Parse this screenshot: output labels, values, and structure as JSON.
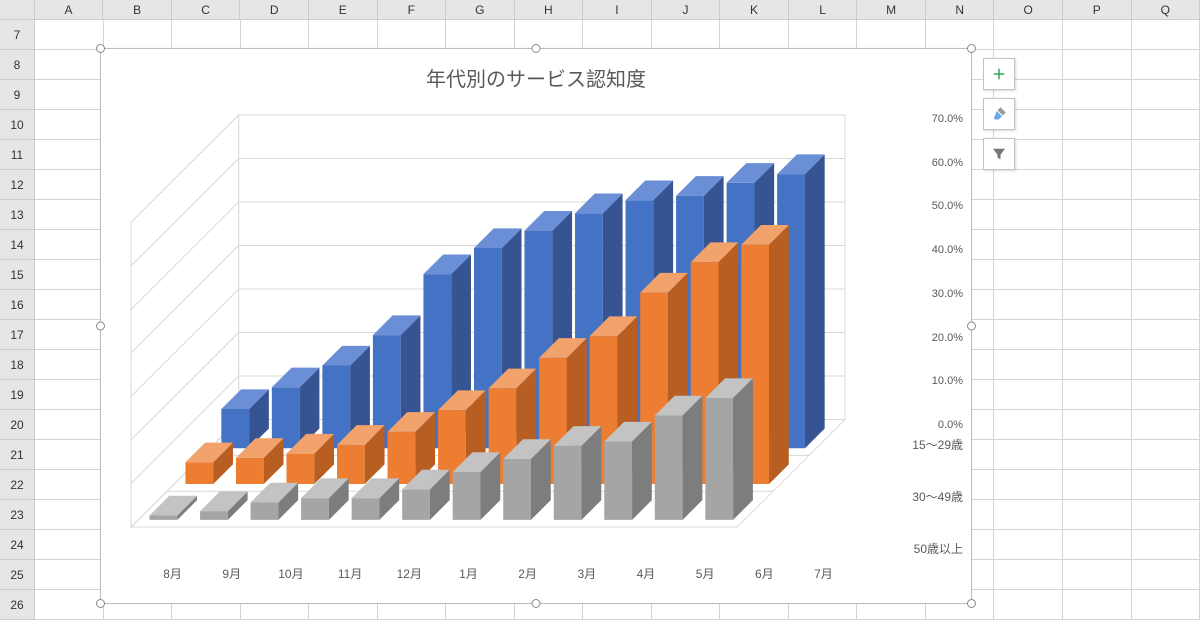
{
  "spreadsheet": {
    "cols": [
      "A",
      "B",
      "C",
      "D",
      "E",
      "F",
      "G",
      "H",
      "I",
      "J",
      "K",
      "L",
      "M",
      "N",
      "O",
      "P",
      "Q"
    ],
    "rows": [
      "7",
      "8",
      "9",
      "10",
      "11",
      "12",
      "13",
      "14",
      "15",
      "16",
      "17",
      "18",
      "19",
      "20",
      "21",
      "22",
      "23",
      "24",
      "25",
      "26"
    ]
  },
  "chart_buttons": {
    "add": "Chart Elements",
    "style": "Chart Styles",
    "filter": "Chart Filters"
  },
  "chart_data": {
    "type": "bar",
    "title": "年代別のサービス認知度",
    "ylabel": "",
    "ylim": [
      0,
      0.7
    ],
    "ytick_labels": [
      "0.0%",
      "10.0%",
      "20.0%",
      "30.0%",
      "40.0%",
      "50.0%",
      "60.0%",
      "70.0%"
    ],
    "categories": [
      "8月",
      "9月",
      "10月",
      "11月",
      "12月",
      "1月",
      "2月",
      "3月",
      "4月",
      "5月",
      "6月",
      "7月"
    ],
    "series": [
      {
        "name": "15～29歳",
        "color": "blue",
        "values": [
          0.09,
          0.14,
          0.19,
          0.26,
          0.4,
          0.46,
          0.5,
          0.54,
          0.57,
          0.58,
          0.61,
          0.63
        ]
      },
      {
        "name": "30～49歳",
        "color": "orange",
        "values": [
          0.05,
          0.06,
          0.07,
          0.09,
          0.12,
          0.17,
          0.22,
          0.29,
          0.34,
          0.44,
          0.51,
          0.55
        ]
      },
      {
        "name": "50歳以上",
        "color": "gray",
        "values": [
          0.01,
          0.02,
          0.04,
          0.05,
          0.05,
          0.07,
          0.11,
          0.14,
          0.17,
          0.18,
          0.24,
          0.28
        ]
      }
    ]
  }
}
